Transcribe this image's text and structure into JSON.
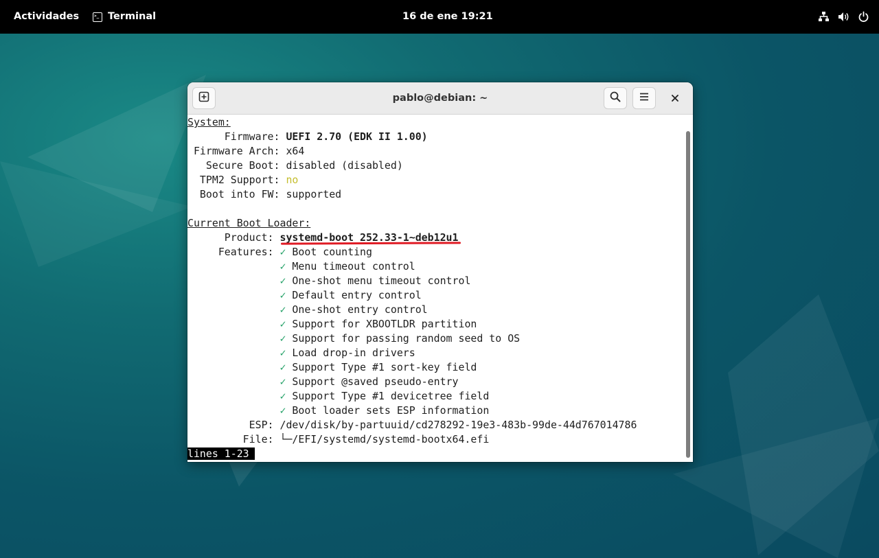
{
  "topbar": {
    "activities": "Actividades",
    "app_name": "Terminal",
    "clock": "16 de ene  19:21",
    "tray_icons": [
      "network-icon",
      "volume-icon",
      "power-icon"
    ]
  },
  "window": {
    "title": "pablo@debian: ~",
    "buttons": [
      "new-tab-icon",
      "search-icon",
      "hamburger-menu-icon",
      "close-icon"
    ]
  },
  "terminal": {
    "system_header": "System:",
    "firmware_label": "      Firmware: ",
    "firmware_value": "UEFI 2.70 (EDK II 1.00)",
    "arch_label": " Firmware Arch: ",
    "arch_value": "x64",
    "secureboot_label": "   Secure Boot: ",
    "secureboot_value": "disabled (disabled)",
    "tpm_label": "  TPM2 Support: ",
    "tpm_value": "no",
    "bootfw_label": "  Boot into FW: ",
    "bootfw_value": "supported",
    "loader_header": "Current Boot Loader:",
    "product_label": "      Product: ",
    "product_value": "systemd-boot 252.33-1~deb12u1",
    "features_label": "     Features: ",
    "check_mark": "✓",
    "features": [
      "Boot counting",
      "Menu timeout control",
      "One-shot menu timeout control",
      "Default entry control",
      "One-shot entry control",
      "Support for XBOOTLDR partition",
      "Support for passing random seed to OS",
      "Load drop-in drivers",
      "Support Type #1 sort-key field",
      "Support @saved pseudo-entry",
      "Support Type #1 devicetree field",
      "Boot loader sets ESP information"
    ],
    "esp_label": "          ESP: ",
    "esp_value": "/dev/disk/by-partuuid/cd278292-19e3-483b-99de-44d767014786",
    "file_label": "         File: ",
    "file_value": "└─/EFI/systemd/systemd-bootx64.efi",
    "status_line": "lines 1-23"
  },
  "colors": {
    "highlight_underline": "#e01b24",
    "check": "#26a269",
    "tpm_no": "#c4bd2c"
  }
}
